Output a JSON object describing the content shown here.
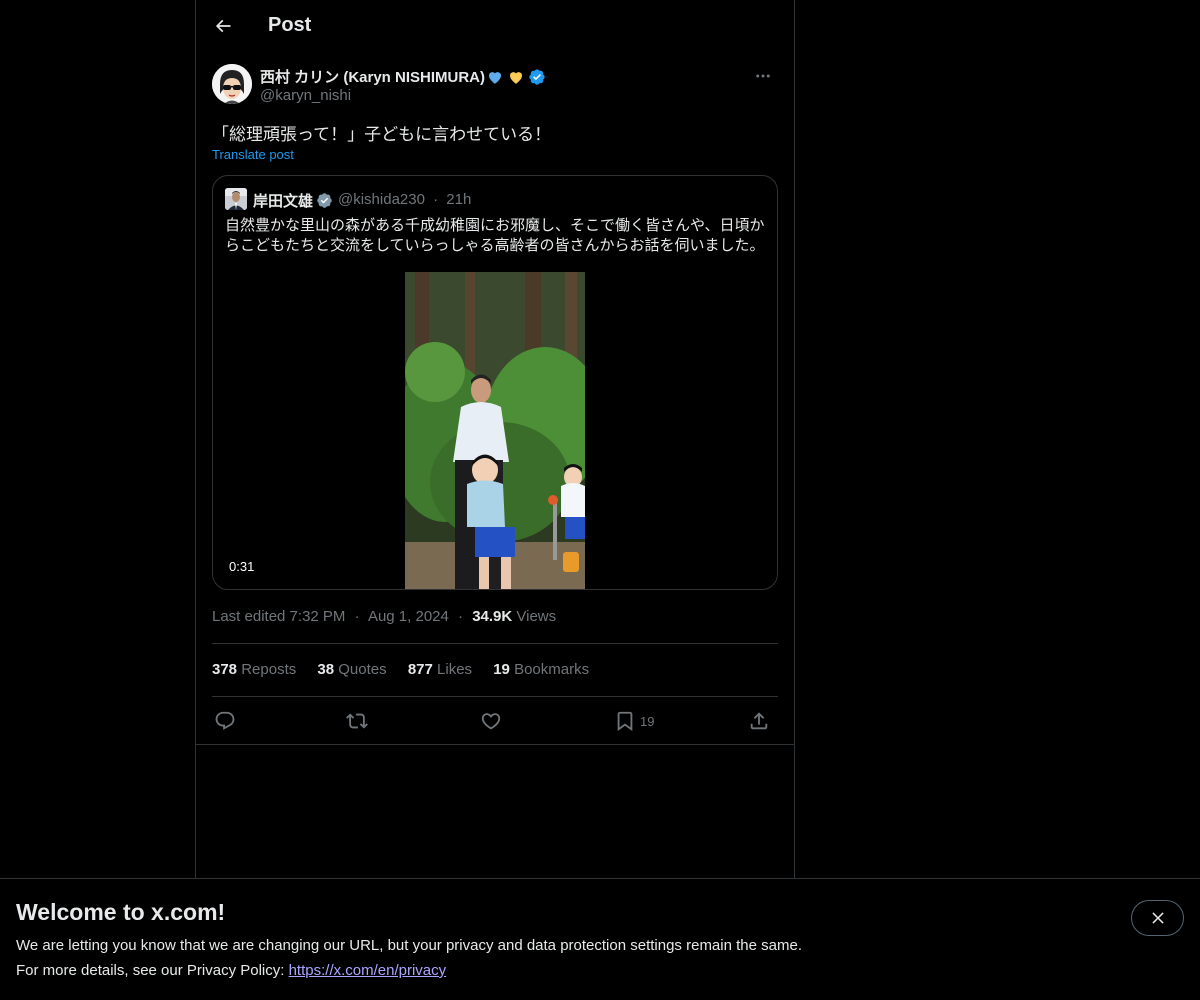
{
  "header": {
    "title": "Post",
    "back_icon": "arrow-left-icon"
  },
  "post": {
    "author_name": "西村 カリン (Karyn NISHIMURA)",
    "author_emojis": [
      "blue-heart",
      "yellow-heart"
    ],
    "author_handle": "@karyn_nishi",
    "verified": true,
    "text": "「総理頑張って！」子どもに言わせている！",
    "translate_label": "Translate post",
    "meta": {
      "edited_label": "Last edited 7:32 PM",
      "date": "Aug 1, 2024",
      "views_count": "34.9K",
      "views_label": "Views",
      "separator": "·"
    },
    "stats": {
      "reposts_count": "378",
      "reposts_label": "Reposts",
      "quotes_count": "38",
      "quotes_label": "Quotes",
      "likes_count": "877",
      "likes_label": "Likes",
      "bookmarks_count": "19",
      "bookmarks_label": "Bookmarks"
    },
    "actions": {
      "bookmark_count": "19"
    }
  },
  "quote": {
    "name": "岸田文雄",
    "handle": "@kishida230",
    "separator": "·",
    "time": "21h",
    "text": "自然豊かな里山の森がある千成幼稚園にお邪魔し、そこで働く皆さんや、日頃からこどもたちと交流をしていらっしゃる高齢者の皆さんからお話を伺いました。",
    "video_duration": "0:31"
  },
  "banner": {
    "title": "Welcome to x.com!",
    "line1": "We are letting you know that we are changing our URL, but your privacy and data protection settings remain the same.",
    "line2_prefix": "For more details, see our Privacy Policy: ",
    "link": "https://x.com/en/privacy"
  },
  "colors": {
    "background": "#000000",
    "text_primary": "#e7e9ea",
    "text_secondary": "#71767b",
    "accent": "#1d9bf0",
    "border": "#2f3336",
    "link": "#a9a6ff"
  }
}
